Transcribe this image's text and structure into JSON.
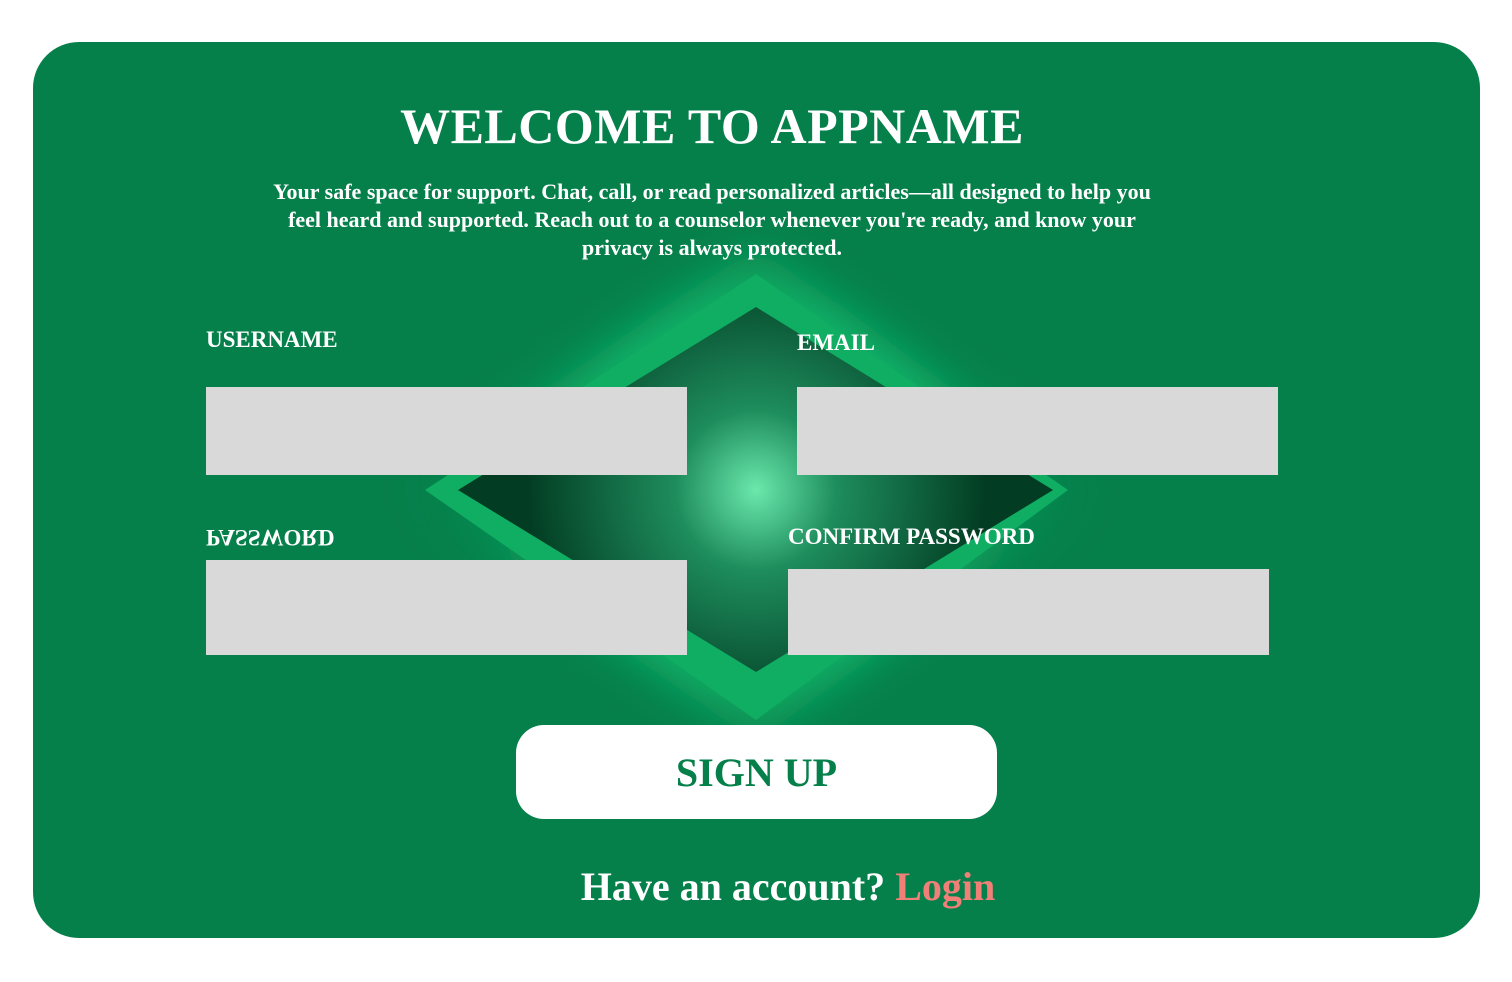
{
  "header": {
    "title": "WELCOME TO APPNAME",
    "subtitle": "Your safe space for support. Chat, call, or read personalized articles—all designed to help you feel heard and supported. Reach out to a counselor whenever you're ready, and know your privacy is always protected."
  },
  "form": {
    "username_label": "USERNAME",
    "email_label": "EMAIL",
    "password_label": "PASSWORD",
    "confirm_password_label": "CONFIRM PASSWORD",
    "username_value": "",
    "email_value": "",
    "password_value": "",
    "confirm_password_value": ""
  },
  "actions": {
    "signup_label": "SIGN UP"
  },
  "footer": {
    "prompt": "Have an account?",
    "login_label": "Login"
  },
  "colors": {
    "background": "#ffffff",
    "card": "#06804b",
    "input": "#d9d9d9",
    "button": "#ffffff",
    "button_text": "#06804b",
    "link": "#f07f78"
  }
}
